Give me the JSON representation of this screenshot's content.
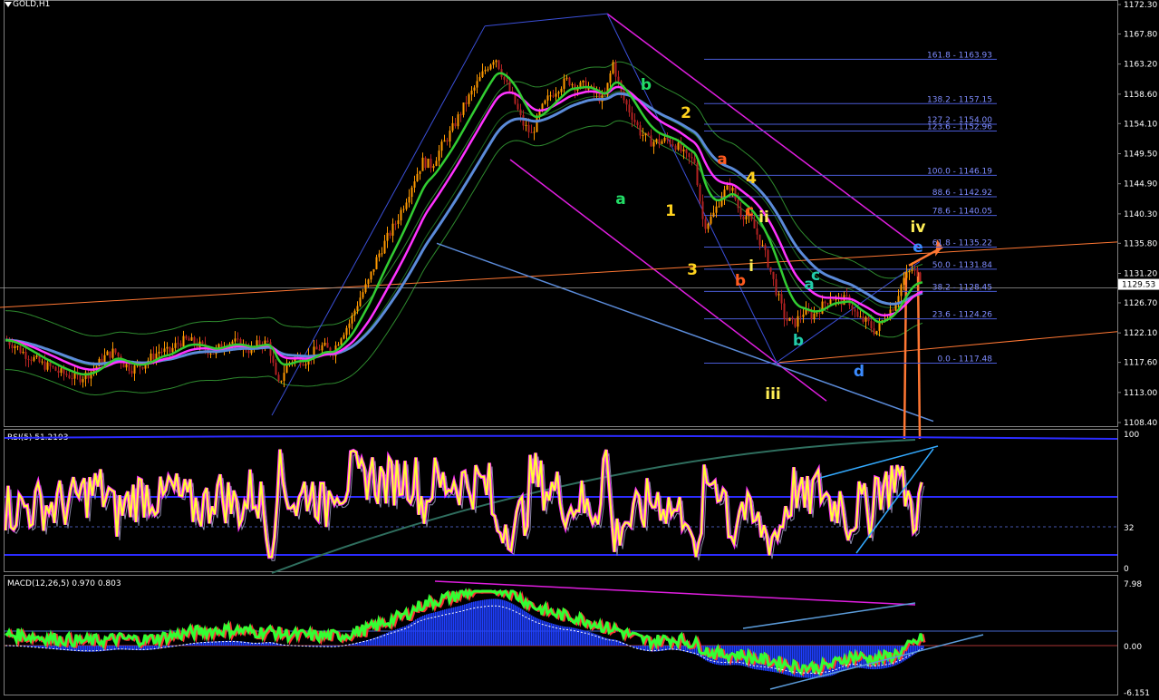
{
  "window": {
    "symbol_title": "GOLD,H1"
  },
  "colors": {
    "background": "#000000",
    "grid_frame": "#808080",
    "candle_up": "#ff9900",
    "candle_down": "#b22222",
    "ma_fast": "#32cd32",
    "ma_mid": "#ff33ff",
    "ma_slow": "#5b8bd9",
    "envelope": "#2e8b2e",
    "channel_magenta": "#e01ee0",
    "trend_orange": "#ff7733",
    "fib_line": "#4a5bd6",
    "rsi_main": "#ffff33",
    "rsi_shadow": "#ff33ff",
    "rsi_band": "#2b2bff",
    "macd_hist": "#1f3fff",
    "macd_main": "#33ff33",
    "macd_signal": "#ff3333"
  },
  "main_axis": {
    "ticks": [
      "1172.30",
      "1167.80",
      "1163.20",
      "1158.60",
      "1154.10",
      "1149.50",
      "1144.90",
      "1140.30",
      "1135.80",
      "1131.20",
      "1126.70",
      "1122.10",
      "1117.60",
      "1113.00",
      "1108.40"
    ],
    "current_price": "1129.53"
  },
  "fib_levels": [
    {
      "label": "161.8 - 1163.93",
      "price": 1163.93
    },
    {
      "label": "138.2 - 1157.15",
      "price": 1157.15
    },
    {
      "label": "127.2 - 1154.00",
      "price": 1154.0
    },
    {
      "label": "123.6 - 1152.96",
      "price": 1152.96
    },
    {
      "label": "100.0 - 1146.19",
      "price": 1146.19
    },
    {
      "label": "88.6 - 1142.92",
      "price": 1142.92
    },
    {
      "label": "78.6 - 1140.05",
      "price": 1140.05
    },
    {
      "label": "61.8 - 1135.22",
      "price": 1135.22
    },
    {
      "label": "50.0 - 1131.84",
      "price": 1131.84
    },
    {
      "label": "38.2 - 1128.45",
      "price": 1128.45
    },
    {
      "label": "23.6 - 1124.26",
      "price": 1124.26
    },
    {
      "label": "0.0 - 1117.48",
      "price": 1117.48
    }
  ],
  "wave_labels": [
    {
      "text": "b",
      "color": "#22dd66"
    },
    {
      "text": "a",
      "color": "#22dd66"
    },
    {
      "text": "2",
      "color": "#ffd21e"
    },
    {
      "text": "1",
      "color": "#ffd21e"
    },
    {
      "text": "3",
      "color": "#ffd21e"
    },
    {
      "text": "4",
      "color": "#ffd21e"
    },
    {
      "text": "a",
      "color": "#ff5a1e"
    },
    {
      "text": "c",
      "color": "#ff5a1e"
    },
    {
      "text": "b",
      "color": "#ff5a1e"
    },
    {
      "text": "ii",
      "color": "#ffee55"
    },
    {
      "text": "i",
      "color": "#ffee55"
    },
    {
      "text": "iii",
      "color": "#ffee55"
    },
    {
      "text": "iv",
      "color": "#ffee55"
    },
    {
      "text": "a",
      "color": "#22ccaa"
    },
    {
      "text": "b",
      "color": "#22ccaa"
    },
    {
      "text": "c",
      "color": "#22ccaa"
    },
    {
      "text": "d",
      "color": "#3b8bff"
    },
    {
      "text": "e",
      "color": "#3b8bff"
    }
  ],
  "rsi_panel": {
    "title": "RSI(5) 51.2193",
    "axis_ticks": [
      "100",
      "32",
      "0"
    ]
  },
  "macd_panel": {
    "title": "MACD(12,26,5) 0.970 0.803",
    "axis_ticks": [
      "7.98",
      "0.00",
      "-6.151"
    ]
  },
  "chart_data": {
    "type": "line",
    "title": "GOLD,H1",
    "ylim": [
      1108.4,
      1172.3
    ],
    "x": [
      0,
      10,
      20,
      30,
      40,
      50,
      60,
      70,
      80,
      90,
      100,
      110,
      120,
      130,
      140,
      150,
      160,
      170,
      180,
      190,
      200,
      210,
      220,
      230,
      240,
      250,
      260,
      270,
      280,
      290,
      300,
      310,
      320,
      330,
      340,
      350,
      360,
      370,
      380,
      390,
      400,
      410,
      420,
      430,
      440,
      450,
      460,
      470,
      480,
      490,
      500,
      510,
      520,
      530,
      540,
      550,
      560,
      570,
      580,
      590,
      600,
      610,
      620,
      630,
      640,
      650,
      660,
      670,
      680,
      690,
      700,
      710,
      720,
      730,
      740,
      750,
      760,
      770,
      780,
      790,
      800,
      810,
      820,
      830,
      840,
      850,
      860,
      870,
      880,
      890,
      900,
      910,
      920,
      930,
      940,
      950,
      960,
      970,
      980,
      990,
      1000,
      1010
    ],
    "series": [
      {
        "values": [
          1121.0,
          1120.2,
          1119.0,
          1118.2,
          1117.3,
          1116.8,
          1116.0,
          1115.6,
          1115.2,
          1115.8,
          1117.0,
          1118.6,
          1119.3,
          1117.4,
          1116.6,
          1117.2,
          1118.3,
          1119.4,
          1119.1,
          1120.6,
          1121.0,
          1120.4,
          1119.7,
          1119.1,
          1120.4,
          1120.8,
          1120.2,
          1119.4,
          1120.6,
          1120.5,
          1113.8,
          1117.3,
          1118.4,
          1117.8,
          1119.2,
          1120.1,
          1119.0,
          1121.8,
          1123.8,
          1127.3,
          1129.9,
          1133.7,
          1136.4,
          1138.9,
          1142.0,
          1145.4,
          1148.3,
          1147.7,
          1150.4,
          1152.6,
          1155.3,
          1157.9,
          1160.2,
          1162.6,
          1164.4,
          1160.8,
          1157.9,
          1154.2,
          1152.4,
          1156.0,
          1158.3,
          1159.7,
          1160.8,
          1159.7,
          1160.0,
          1158.6,
          1157.6,
          1163.4,
          1158.2,
          1155.6,
          1152.8,
          1151.4,
          1151.3,
          1151.6,
          1150.8,
          1149.0,
          1148.3,
          1138.5,
          1139.9,
          1143.2,
          1144.6,
          1140.5,
          1139.8,
          1136.9,
          1133.3,
          1128.6,
          1124.2,
          1123.5,
          1125.3,
          1124.7,
          1126.1,
          1127.6,
          1127.0,
          1127.2,
          1124.3,
          1123.8,
          1122.2,
          1124.6,
          1126.3,
          1130.2,
          1131.8,
          1130.3
        ]
      }
    ]
  }
}
